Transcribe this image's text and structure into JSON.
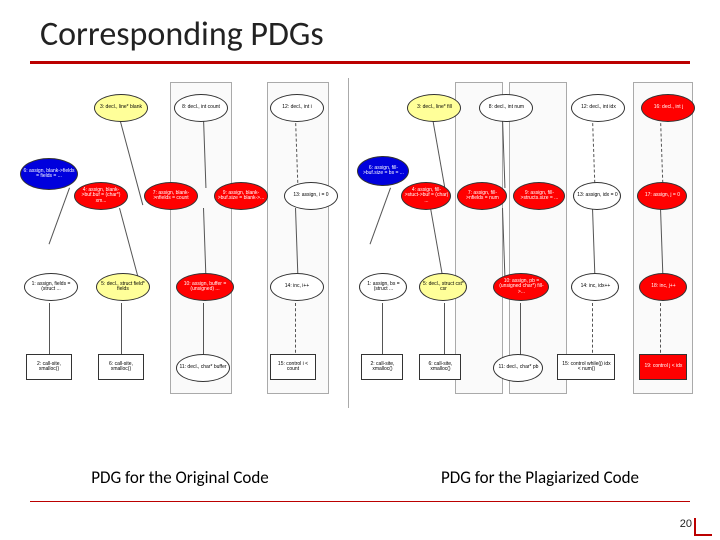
{
  "title": "Corresponding PDGs",
  "captions": {
    "left": "PDG for the Original Code",
    "right": "PDG for the Plagiarized Code"
  },
  "page": "20",
  "left": {
    "r1": [
      "3: decl.,\nline* blank",
      "8: decl.,\nint count",
      "12: decl.,\nint i"
    ],
    "blue": "6: assign,\nblank->fields =\nfields = ...",
    "r2": [
      "4: assign,\nblank->buf.buf\n= (char*) xm...",
      "7: assign,\nblank->nfields =\ncount",
      "9: assign,\nblank->buf.size\n= blank->...",
      "13: assign,\ni = 0"
    ],
    "r3": [
      "1: assign,\nfields =\n(struct ...",
      "5: decl.,\nstruct field*\nfields",
      "10: assign, buffer\n= (unsigned) ...",
      "14: inc,\ni++"
    ],
    "r4": [
      "2: call-site,\nxmalloc()",
      "6: call-site,\nxmalloc()",
      "11: decl.,\nchar* buffer",
      "15: control\ni < count"
    ]
  },
  "right": {
    "r1": [
      "3: decl.,\nline* fill",
      "8: decl.,\nint num",
      "12: decl.,\nint idx",
      "16: decl.,\nint j"
    ],
    "blue": "6: assign,\nfill->buf.size =\nbs = ...",
    "r2": [
      "4: assign,\nfill->stuct->buf =\n(char) ...",
      "7: assign,\nfill->nfields =\nnum",
      "9: assign,\nfill->structs.size\n= ...",
      "13: assign,\nidx = 0",
      "17: assign,\nj = 0"
    ],
    "r3": [
      "1: assign,\nbs = (struct ...",
      "5: decl.,\nstruct cst*\ncsr",
      "10: assign, pb =\n(unsigned\nchar*) fill->...",
      "14: inc,\nidx++",
      "18: inc,\nj++"
    ],
    "r4": [
      "2: call-site,\nxmalloc()",
      "6: call-site,\nxmalloc()",
      "11: decl.,\nchar* pb",
      "15: control\nwhile(j) idx < num()",
      "19: control\nj < idx"
    ]
  }
}
